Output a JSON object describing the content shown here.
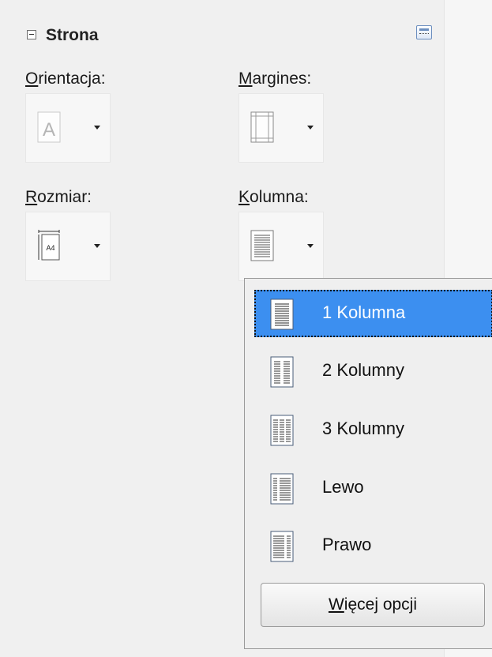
{
  "panel": {
    "title": "Strona"
  },
  "fields": {
    "orientation": {
      "accel": "O",
      "rest": "rientacja:"
    },
    "margins": {
      "accel": "M",
      "rest": "argines:"
    },
    "size": {
      "accel": "R",
      "rest": "ozmiar:",
      "icon_text": "A4"
    },
    "columns": {
      "accel": "K",
      "rest": "olumna:"
    }
  },
  "dropdown": {
    "items": [
      {
        "label": "1 Kolumna",
        "icon": "one-column-icon",
        "selected": true
      },
      {
        "label": "2 Kolumny",
        "icon": "two-columns-icon",
        "selected": false
      },
      {
        "label": "3 Kolumny",
        "icon": "three-columns-icon",
        "selected": false
      },
      {
        "label": "Lewo",
        "icon": "left-column-icon",
        "selected": false
      },
      {
        "label": "Prawo",
        "icon": "right-column-icon",
        "selected": false
      }
    ],
    "more_button": {
      "accel": "W",
      "rest": "ięcej opcji"
    }
  },
  "colors": {
    "selection": "#3c8ff0",
    "icon_frame": "#4a5d78"
  }
}
